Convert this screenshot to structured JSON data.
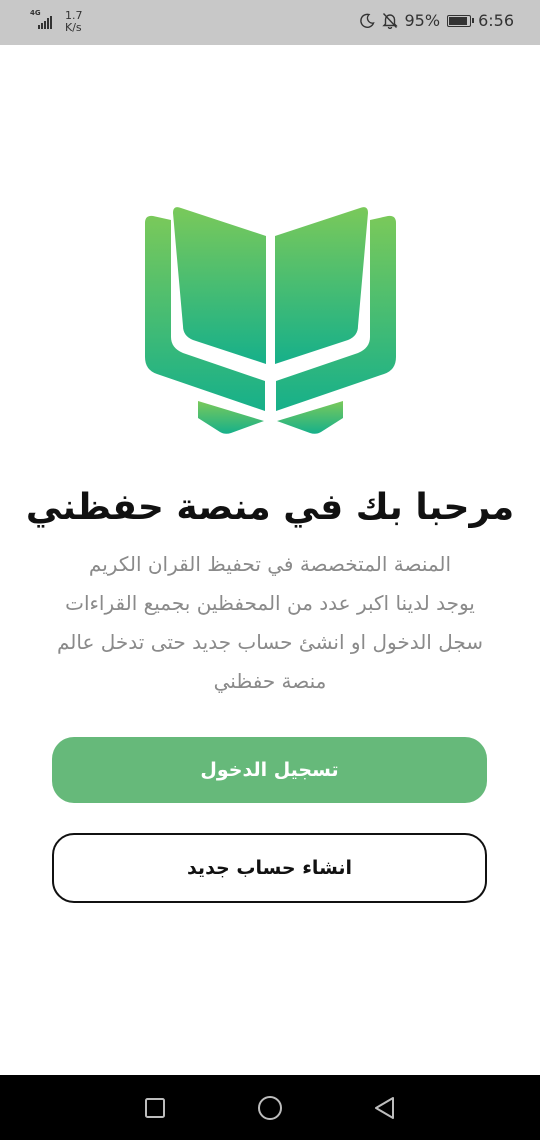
{
  "status_bar": {
    "network_type": "4G",
    "speed_value": "1.7",
    "speed_unit": "K/s",
    "battery": "95%",
    "time": "6:56",
    "icons": [
      "signal-icon",
      "moon-icon",
      "bell-off-icon",
      "battery-icon"
    ]
  },
  "logo": {
    "icon": "open-book-icon",
    "gradient_top": "#7ac95a",
    "gradient_bottom": "#16b08a"
  },
  "welcome": {
    "title": "مرحبا بك في منصة حفظني",
    "description_lines": [
      "المنصة المتخصصة في تحفيظ القران الكريم",
      "يوجد لدينا اكبر عدد من المحفظين بجميع القراءات",
      "سجل الدخول او انشئ حساب جديد حتى تدخل عالم",
      "منصة حفظني"
    ]
  },
  "buttons": {
    "login_label": "تسجيل الدخول",
    "register_label": "انشاء حساب جديد"
  },
  "colors": {
    "primary": "#66b97a",
    "status_bar": "#c8c8c8",
    "nav_bar": "#000000"
  },
  "nav_bar": {
    "icons": [
      "square-recents-icon",
      "circle-home-icon",
      "triangle-back-icon"
    ]
  }
}
